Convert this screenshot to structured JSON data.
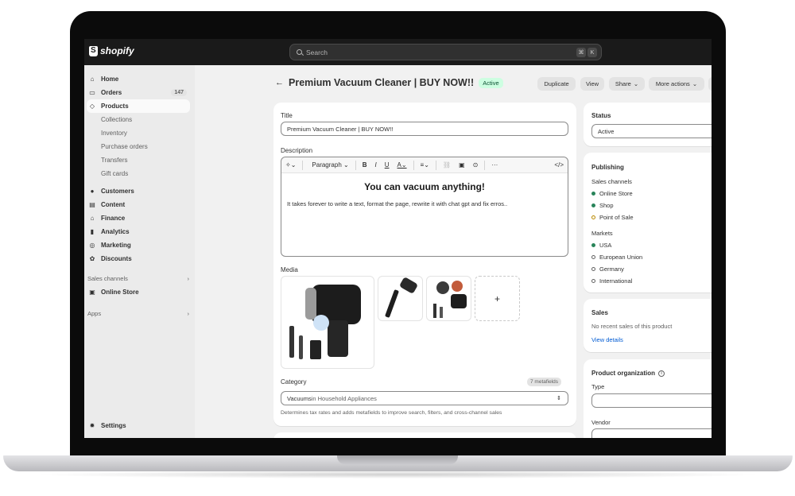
{
  "app": {
    "brand": "shopify"
  },
  "search": {
    "placeholder": "Search",
    "kbd1": "⌘",
    "kbd2": "K"
  },
  "sidebar": {
    "items": [
      {
        "label": "Home",
        "icon": "home-icon"
      },
      {
        "label": "Orders",
        "icon": "inbox-icon",
        "badge": "147"
      },
      {
        "label": "Products",
        "icon": "tag-icon"
      },
      {
        "label": "Customers",
        "icon": "person-icon"
      },
      {
        "label": "Content",
        "icon": "content-icon"
      },
      {
        "label": "Finance",
        "icon": "bank-icon"
      },
      {
        "label": "Analytics",
        "icon": "bar-chart-icon"
      },
      {
        "label": "Marketing",
        "icon": "target-icon"
      },
      {
        "label": "Discounts",
        "icon": "discount-icon"
      }
    ],
    "product_sub": [
      "Collections",
      "Inventory",
      "Purchase orders",
      "Transfers",
      "Gift cards"
    ],
    "sales_channels_label": "Sales channels",
    "online_store": "Online Store",
    "apps_label": "Apps",
    "settings": "Settings"
  },
  "header": {
    "title": "Premium Vacuum Cleaner | BUY NOW!!",
    "status": "Active",
    "duplicate": "Duplicate",
    "view": "View",
    "share": "Share",
    "more_actions": "More actions"
  },
  "form": {
    "title_label": "Title",
    "title_value": "Premium Vacuum Cleaner | BUY NOW!!",
    "description_label": "Description",
    "toolbar_format": "Paragraph",
    "heading": "You can vacuum anything!",
    "body": "It takes forever to write a text, format the page, rewrite it with chat gpt and fix erros..",
    "media_label": "Media",
    "add_media": "+",
    "category_label": "Category",
    "metafields_badge": "7 metafields",
    "category_value": "Vacuums",
    "category_suffix": " in Household Appliances",
    "category_help": "Determines tax rates and adds metafields to improve search, filters, and cross-channel sales"
  },
  "status_card": {
    "label": "Status",
    "value": "Active"
  },
  "publishing": {
    "title": "Publishing",
    "channels_label": "Sales channels",
    "channels": [
      {
        "name": "Online Store",
        "state": "on"
      },
      {
        "name": "Shop",
        "state": "on"
      },
      {
        "name": "Point of Sale",
        "state": "partial"
      }
    ],
    "markets_label": "Markets",
    "markets": [
      {
        "name": "USA",
        "state": "on"
      },
      {
        "name": "European Union",
        "state": "off"
      },
      {
        "name": "Germany",
        "state": "off"
      },
      {
        "name": "International",
        "state": "off"
      }
    ]
  },
  "sales": {
    "title": "Sales",
    "empty": "No recent sales of this product",
    "link": "View details"
  },
  "organization": {
    "title": "Product organization",
    "type_label": "Type",
    "vendor_label": "Vendor"
  },
  "colors": {
    "accent_green": "#29845a",
    "partial_orange": "#b98900",
    "link_blue": "#005bd3"
  }
}
